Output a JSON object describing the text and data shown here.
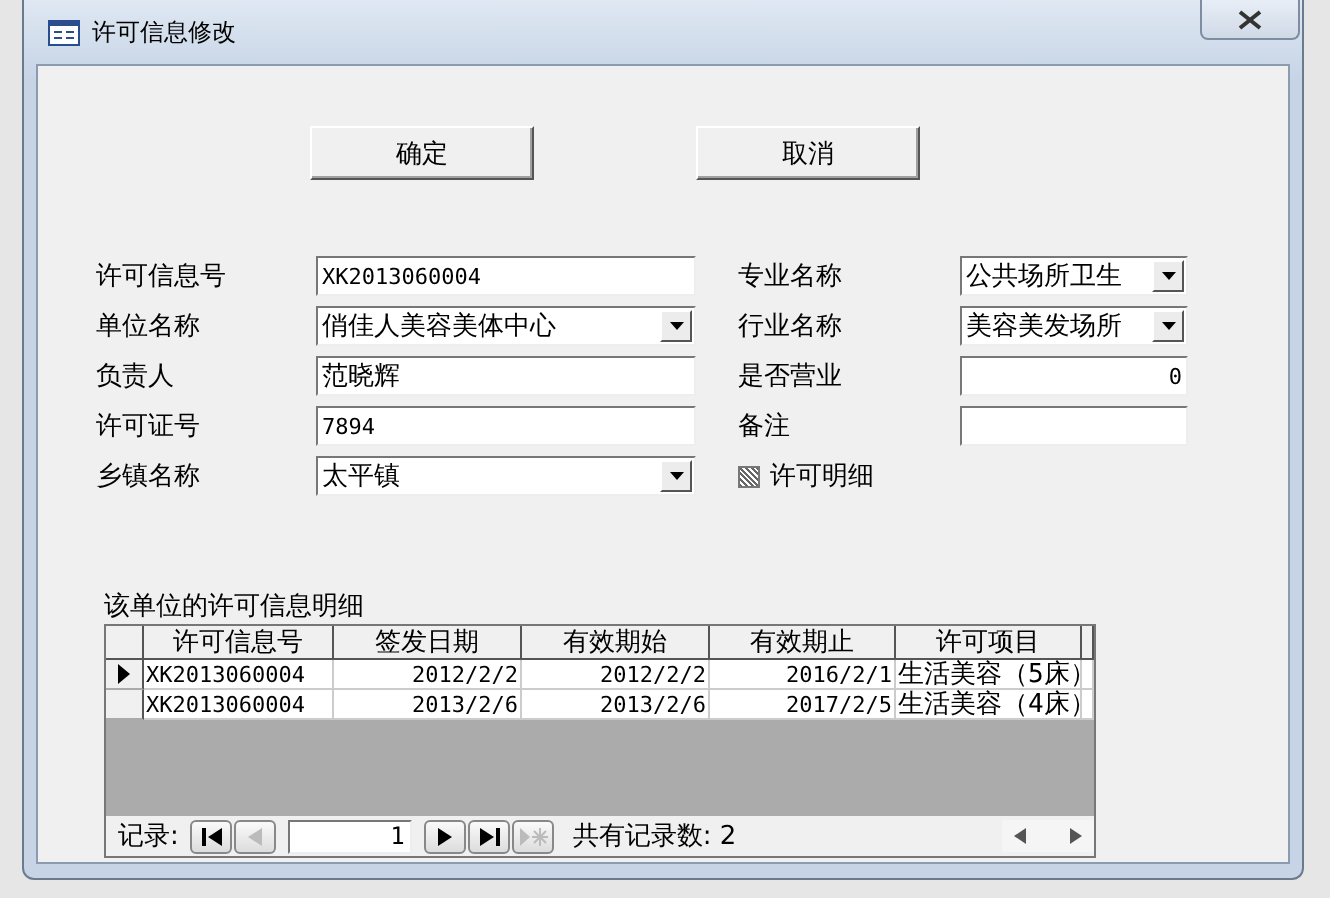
{
  "window": {
    "title": "许可信息修改"
  },
  "buttons": [
    {
      "label": "确定"
    },
    {
      "label": "取消"
    }
  ],
  "fields": [
    {
      "label": "许可信息号",
      "kind": "text",
      "value": "XK2013060004"
    },
    {
      "label": "专业名称",
      "kind": "combo",
      "value": "公共场所卫生"
    },
    {
      "label": "单位名称",
      "kind": "combo",
      "value": "俏佳人美容美体中心"
    },
    {
      "label": "行业名称",
      "kind": "combo",
      "value": "美容美发场所"
    },
    {
      "label": "负责人",
      "kind": "text",
      "value": "范晓辉"
    },
    {
      "label": "是否营业",
      "kind": "number",
      "value": "0"
    },
    {
      "label": "许可证号",
      "kind": "text",
      "value": "7894"
    },
    {
      "label": "备注",
      "kind": "text"
    },
    {
      "label": "乡镇名称",
      "kind": "combo",
      "value": "太平镇"
    }
  ],
  "detail_checkbox": {
    "label": "许可明细",
    "indeterminate": true
  },
  "subform": {
    "title": "该单位的许可信息明细",
    "columns": [
      {
        "label": "许可信息号",
        "kind": "text"
      },
      {
        "label": "签发日期",
        "kind": "date"
      },
      {
        "label": "有效期始",
        "kind": "date"
      },
      {
        "label": "有效期止",
        "kind": "date"
      },
      {
        "label": "许可项目",
        "kind": "text"
      }
    ],
    "rows": [
      {
        "selected": true,
        "cells": [
          "XK2013060004",
          "2012/2/2",
          "2012/2/2",
          "2016/2/1",
          "生活美容（5床）"
        ]
      },
      {
        "selected": false,
        "cells": [
          "XK2013060004",
          "2013/2/6",
          "2013/2/6",
          "2017/2/5",
          "生活美容（4床）"
        ]
      }
    ],
    "navigation": {
      "label": "记录:",
      "record": "1",
      "count_text": "共有记录数: 2",
      "first_disabled": false,
      "prev_disabled": true,
      "next_disabled": false,
      "last_disabled": false,
      "new_disabled": true
    }
  }
}
